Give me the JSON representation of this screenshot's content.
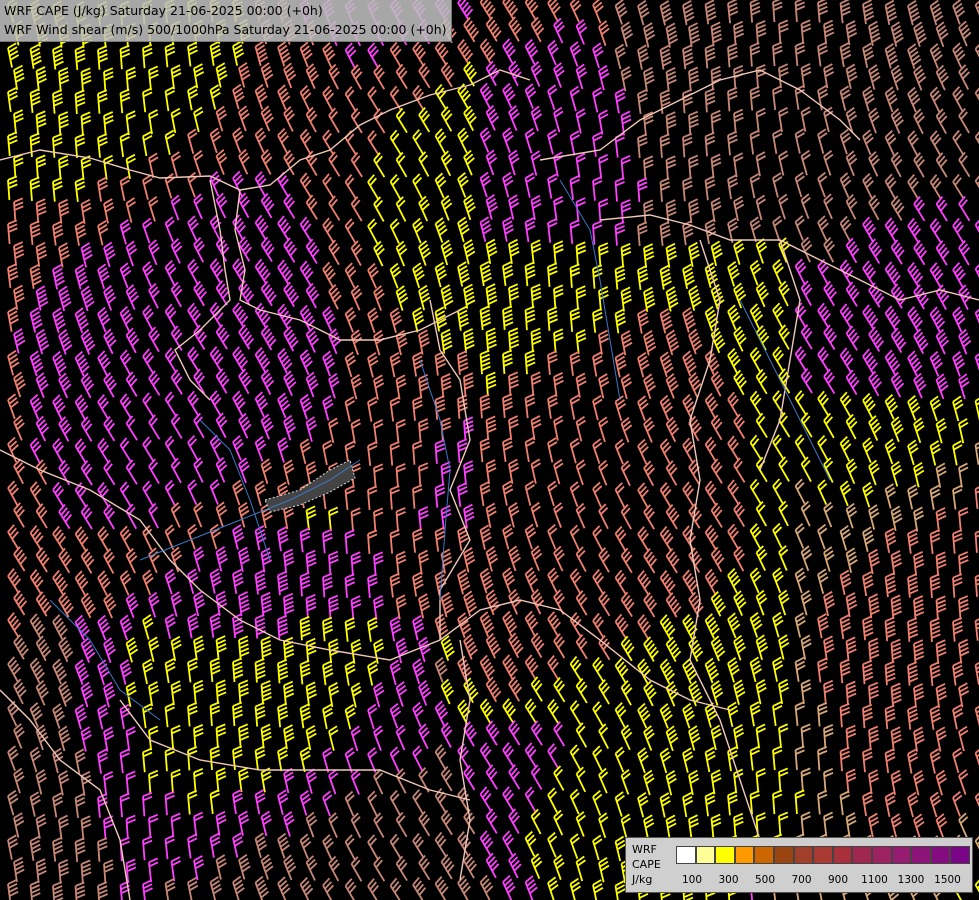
{
  "header": {
    "line1": "WRF CAPE (J/kg) Saturday 21-06-2025 00:00 (+0h)",
    "line2": "WRF Wind shear (m/s) 500/1000hPa Saturday 21-06-2025 00:00 (+0h)"
  },
  "legend": {
    "label_model": "WRF",
    "label_var": "CAPE",
    "label_unit": "J/kg",
    "colors": [
      "#ffffff",
      "#ffff99",
      "#ffff00",
      "#ff9900",
      "#cc6600",
      "#994411",
      "#a0402a",
      "#a83a33",
      "#a8303d",
      "#a02850",
      "#9c2262",
      "#961c72",
      "#8c1478",
      "#840c80",
      "#7a0486"
    ],
    "ticks": [
      "100",
      "300",
      "500",
      "700",
      "900",
      "1100",
      "1300",
      "1500"
    ]
  },
  "barb_colors": {
    "yellow": "#ffff00",
    "salmon": "#f08070",
    "pink": "#ff40ff",
    "brown": "#c88878",
    "tan": "#d8a878"
  },
  "boundary_colors": {
    "border": "#f0c8b8",
    "river": "#3a78c8"
  }
}
